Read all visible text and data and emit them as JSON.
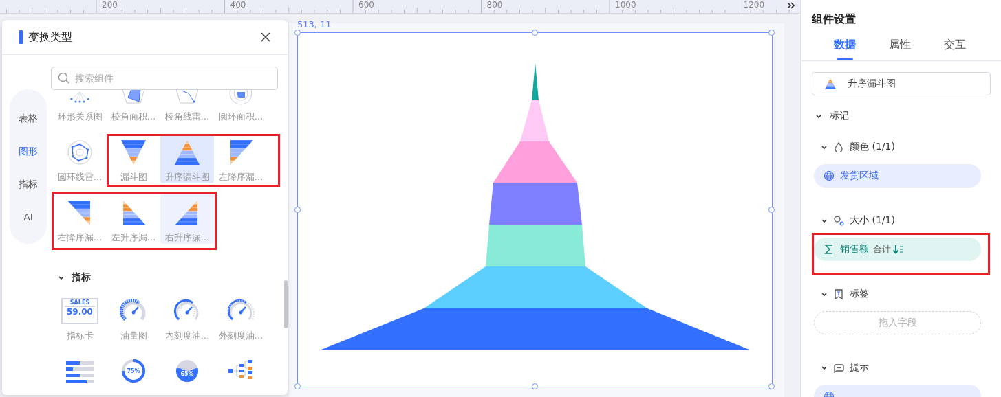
{
  "ruler": {
    "labels": [
      "200",
      "400",
      "600",
      "800",
      "1000",
      "1200"
    ]
  },
  "canvas": {
    "position_label": "513, 11"
  },
  "transform_panel": {
    "title": "变换类型",
    "nav": [
      {
        "label": "表格",
        "selected": false
      },
      {
        "label": "图形",
        "selected": true
      },
      {
        "label": "指标",
        "selected": false
      },
      {
        "label": "AI",
        "selected": false
      }
    ],
    "search": {
      "placeholder": "搜索组件"
    },
    "groups": [
      {
        "items": [
          {
            "kind": "relation",
            "label": "环形关系图",
            "selected": false,
            "hovered": false
          },
          {
            "kind": "radar-area",
            "label": "棱角面积…",
            "selected": false,
            "hovered": false
          },
          {
            "kind": "radar-line",
            "label": "棱角线雷…",
            "selected": false,
            "hovered": false
          },
          {
            "kind": "polar-area",
            "label": "圆环面积…",
            "selected": false,
            "hovered": false
          },
          {
            "kind": "polar-line",
            "label": "圆环线雷…",
            "selected": false,
            "hovered": false
          },
          {
            "kind": "funnel-down",
            "label": "漏斗图",
            "selected": false,
            "hovered": false
          },
          {
            "kind": "funnel-up",
            "label": "升序漏斗图",
            "selected": true,
            "hovered": false
          },
          {
            "kind": "funnel-left-down",
            "label": "左降序漏…",
            "selected": false,
            "hovered": false
          },
          {
            "kind": "funnel-right-down",
            "label": "右降序漏…",
            "selected": false,
            "hovered": false
          },
          {
            "kind": "funnel-left-up",
            "label": "左升序漏…",
            "selected": false,
            "hovered": false
          },
          {
            "kind": "funnel-right-up",
            "label": "右升序漏…",
            "selected": false,
            "hovered": true
          }
        ]
      },
      {
        "title": "指标",
        "expanded": true,
        "items": [
          {
            "kind": "kpi-card",
            "label": "指标卡",
            "caption": "SALES",
            "value": "59.00",
            "selected": false,
            "hovered": false
          },
          {
            "kind": "gauge-fuel",
            "label": "油量图",
            "selected": false,
            "hovered": false
          },
          {
            "kind": "gauge-inner",
            "label": "内刻度油…",
            "selected": false,
            "hovered": false
          },
          {
            "kind": "gauge-outer",
            "label": "外刻度油…",
            "selected": false,
            "hovered": false
          },
          {
            "kind": "progress-bars",
            "selected": false,
            "hovered": false
          },
          {
            "kind": "ring",
            "value": "75%",
            "selected": false,
            "hovered": false
          },
          {
            "kind": "liquid",
            "value": "65%",
            "selected": false,
            "hovered": false
          },
          {
            "kind": "tree",
            "selected": false,
            "hovered": false
          }
        ]
      }
    ]
  },
  "settings_panel": {
    "title": "组件设置",
    "tabs": [
      {
        "label": "数据",
        "selected": true
      },
      {
        "label": "属性",
        "selected": false
      },
      {
        "label": "交互",
        "selected": false
      }
    ],
    "chart_type": {
      "value": "升序漏斗图"
    },
    "sections": [
      {
        "title": "标记",
        "expanded": true,
        "children": [
          {
            "kind": "color",
            "title": "颜色",
            "count": "(1/1)",
            "expanded": true,
            "fields": [
              {
                "kind": "dimension",
                "name": "发货区域"
              }
            ]
          },
          {
            "kind": "size",
            "title": "大小",
            "count": "(1/1)",
            "expanded": true,
            "fields": [
              {
                "kind": "measure",
                "name": "销售额",
                "aggregation": "合计",
                "sorted": true
              }
            ]
          },
          {
            "kind": "label",
            "title": "标签",
            "expanded": true,
            "placeholder": "拖入字段"
          },
          {
            "kind": "tooltip",
            "title": "提示",
            "expanded": true,
            "fields": [
              {
                "kind": "dimension"
              }
            ]
          }
        ]
      }
    ]
  }
}
